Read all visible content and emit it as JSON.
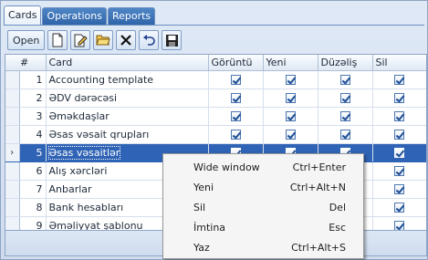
{
  "tabs": [
    {
      "label": "Cards",
      "active": true
    },
    {
      "label": "Operations",
      "active": false
    },
    {
      "label": "Reports",
      "active": false
    }
  ],
  "toolbar": {
    "open_label": "Open",
    "icons": [
      "new-document-icon",
      "edit-document-icon",
      "open-folder-icon",
      "delete-icon",
      "undo-icon",
      "save-icon"
    ]
  },
  "grid": {
    "columns": [
      "#",
      "Card",
      "Görüntü",
      "Yeni",
      "Düzəliş",
      "Sil"
    ],
    "rows": [
      {
        "num": "1",
        "card": "Accounting template",
        "goruntu": true,
        "yeni": true,
        "duzelis": true,
        "sil": true
      },
      {
        "num": "2",
        "card": "ƏDV dərəcəsi",
        "goruntu": true,
        "yeni": true,
        "duzelis": true,
        "sil": true
      },
      {
        "num": "3",
        "card": "Əməkdaşlar",
        "goruntu": true,
        "yeni": true,
        "duzelis": true,
        "sil": true
      },
      {
        "num": "4",
        "card": "Əsas vəsait qrupları",
        "goruntu": true,
        "yeni": true,
        "duzelis": true,
        "sil": true
      },
      {
        "num": "5",
        "card": "Əsas vəsaitlər",
        "goruntu": true,
        "yeni": true,
        "duzelis": true,
        "sil": true,
        "selected": true
      },
      {
        "num": "6",
        "card": "Alış xərcləri",
        "goruntu": true,
        "yeni": true,
        "duzelis": true,
        "sil": true
      },
      {
        "num": "7",
        "card": "Anbarlar",
        "goruntu": true,
        "yeni": true,
        "duzelis": true,
        "sil": true
      },
      {
        "num": "8",
        "card": "Bank hesabları",
        "goruntu": true,
        "yeni": true,
        "duzelis": true,
        "sil": true
      },
      {
        "num": "9",
        "card": "Əməliyyat şablonu",
        "goruntu": true,
        "yeni": true,
        "duzelis": true,
        "sil": true
      }
    ],
    "current_row_indicator": "›"
  },
  "context_menu": {
    "items": [
      {
        "label": "Wide window",
        "shortcut": "Ctrl+Enter"
      },
      {
        "label": "Yeni",
        "shortcut": "Ctrl+Alt+N"
      },
      {
        "label": "Sil",
        "shortcut": "Del"
      },
      {
        "label": "İmtina",
        "shortcut": "Esc"
      },
      {
        "label": "Yaz",
        "shortcut": "Ctrl+Alt+S"
      }
    ]
  },
  "colors": {
    "tab_inactive": "#2e63a8",
    "selection": "#2f63b5",
    "checkbox_mark": "#1f4f94"
  }
}
